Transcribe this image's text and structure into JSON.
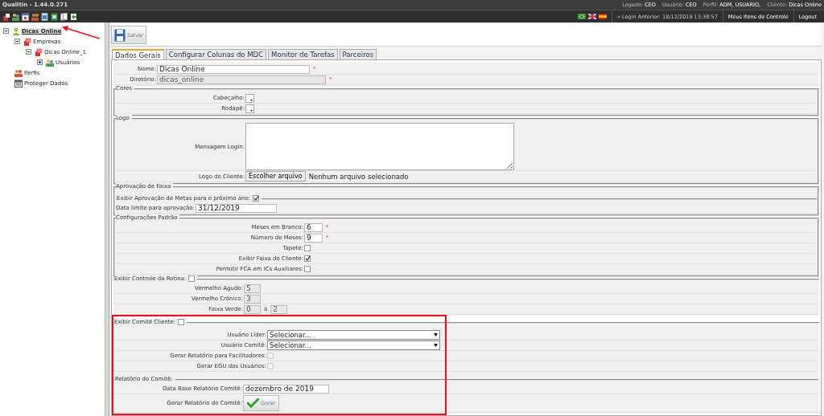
{
  "window": {
    "title": "Qualitin - 1.44.0.271"
  },
  "user_info": [
    {
      "label": "Logado:",
      "value": "CEO"
    },
    {
      "label": "Usuário:",
      "value": "CEO"
    },
    {
      "label": "Perfil:",
      "value": "ADM, USUARIO,"
    },
    {
      "label": "Cliente:",
      "value": "Dicas Online"
    }
  ],
  "last_login": "» Login Anterior: 18/12/2019 13:38:57",
  "header_links": [
    "Meus Itens de Controle",
    "Logout"
  ],
  "tree": [
    {
      "label": "Dicas Online",
      "selected": true,
      "expanded": true,
      "children": [
        {
          "label": "Empresas",
          "selected": false,
          "expanded": true,
          "children": [
            {
              "label": "Dicas Online_1",
              "selected": false,
              "expanded": true,
              "children": [
                {
                  "label": "Usuários",
                  "selected": false,
                  "expanded": false
                }
              ]
            }
          ]
        },
        {
          "label": "Perfis",
          "selected": false
        },
        {
          "label": "Proteger Dados",
          "selected": false
        }
      ]
    }
  ],
  "toolbar": {
    "save_button": "Salvar"
  },
  "tabs": [
    {
      "label": "Dados Gerais",
      "selected": true
    },
    {
      "label": "Configurar Colunas do MDC",
      "selected": false
    },
    {
      "label": "Monitor de Tarefas",
      "selected": false
    },
    {
      "label": "Parceiros",
      "selected": false
    }
  ],
  "sections": [
    {
      "rows": [
        {
          "kind": "text",
          "label": "Nome:",
          "value": "Dicas Online",
          "disabled": false,
          "required_mark": "*"
        },
        {
          "kind": "text",
          "label": "Diretório:",
          "value": "dicas_online",
          "disabled": true,
          "required_mark": "*"
        }
      ]
    },
    {
      "legend": "Cores",
      "rows": [
        {
          "kind": "color",
          "label": "Cabeçalho:"
        },
        {
          "kind": "color",
          "label": "Rodapé:"
        }
      ]
    },
    {
      "legend": "Logo",
      "rows": [
        {
          "kind": "textarea",
          "label": "Mensagem Login:"
        },
        {
          "kind": "file",
          "label": "Logo do Cliente:",
          "button": "Escolher arquivo",
          "status": "Nenhum arquivo selecionado"
        }
      ]
    },
    {
      "legend": "Aprovação de Faixa",
      "subsections": [
        {
          "legend": "Exibir Aprovação de Metas para o próximo ano:",
          "checked": true,
          "rows": [
            {
              "kind": "text",
              "label": "Data limite para aprovação:",
              "value": "31/12/2019",
              "disabled": false
            }
          ]
        }
      ]
    },
    {
      "legend": "Configurações Padrão",
      "rows": [
        {
          "kind": "text",
          "label": "Meses em Branco:",
          "value": "6",
          "disabled": false,
          "required_mark": "*"
        },
        {
          "kind": "text",
          "label": "Número de Meses:",
          "value": "9",
          "disabled": false,
          "required_mark": "*"
        },
        {
          "kind": "checkbox",
          "label": "Tapete:",
          "checked": false,
          "disabled": false
        },
        {
          "kind": "checkbox",
          "label": "Exibir Faixa do Cliente:",
          "checked": true,
          "disabled": false
        },
        {
          "kind": "checkbox",
          "label": "Permitir FCA em ICs Auxiliares:",
          "checked": false,
          "disabled": false
        }
      ]
    },
    {
      "legend": "Exibir Controle da Rotina:",
      "checked": false,
      "rows": [
        {
          "kind": "text",
          "label": "Vermelho Agudo:",
          "value": "5",
          "disabled": true
        },
        {
          "kind": "text",
          "label": "Vermelho Crônico:",
          "value": "3",
          "disabled": true
        },
        {
          "kind": "range",
          "label": "Faixa Verde:",
          "from": "0",
          "separator": "à",
          "to": "2",
          "disabled": true
        }
      ]
    },
    {
      "legend": "Exibir Comitê Cliente:",
      "checked": false,
      "highlighted": true,
      "rows": [
        {
          "kind": "select",
          "label": "Usuário Líder:",
          "value": "Selecionar..."
        },
        {
          "kind": "select",
          "label": "Usuário Comitê:",
          "value": "Selecionar..."
        },
        {
          "kind": "checkbox",
          "label": "Gerar Relatório para Facilitadores:",
          "checked": false,
          "disabled": true
        },
        {
          "kind": "checkbox",
          "label": "Gerar EGU dos Usuários:",
          "checked": false,
          "disabled": true
        }
      ],
      "subsections": [
        {
          "legend": "Relatório do Comitê:",
          "rows": [
            {
              "kind": "text",
              "label": "Data Base Relatório Comitê:",
              "value": "dezembro de 2019",
              "disabled": false
            },
            {
              "kind": "button",
              "label": "Gerar Relatório do Comitê:",
              "button": "Gerar"
            }
          ]
        }
      ]
    }
  ],
  "annotations": [
    {
      "kind": "arrow"
    }
  ]
}
